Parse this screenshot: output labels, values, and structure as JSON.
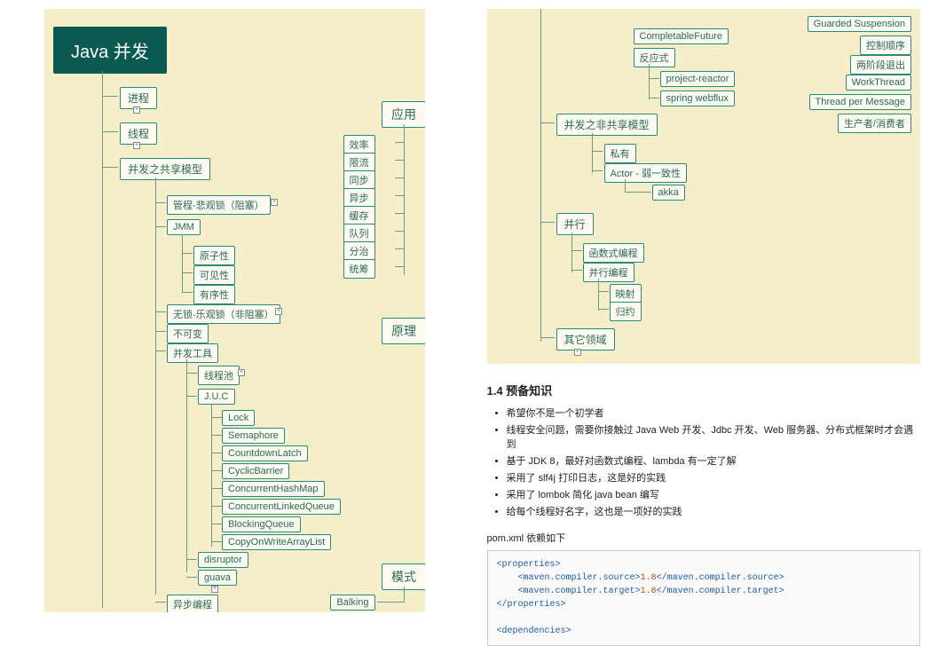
{
  "left": {
    "root": "Java 并发",
    "b1": "进程",
    "b2": "线程",
    "b3": "并发之共享模型",
    "b3_1": "管程-悲观锁（阻塞）",
    "b3_2": "JMM",
    "b3_2_1": "原子性",
    "b3_2_2": "可见性",
    "b3_2_3": "有序性",
    "b3_3": "无锁-乐观锁（非阻塞）",
    "b3_4": "不可变",
    "b3_5": "并发工具",
    "b3_5_1": "线程池",
    "b3_5_2": "J.U.C",
    "juc1": "Lock",
    "juc2": "Semaphore",
    "juc3": "CountdownLatch",
    "juc4": "CyclicBarrier",
    "juc5": "ConcurrentHashMap",
    "juc6": "ConcurrentLinkedQueue",
    "juc7": "BlockingQueue",
    "juc8": "CopyOnWriteArrayList",
    "b3_5_3": "disruptor",
    "b3_5_4": "guava",
    "b3_6": "异步编程",
    "app": "应用",
    "app1": "效率",
    "app2": "限流",
    "app3": "同步",
    "app4": "异步",
    "app5": "缓存",
    "app6": "队列",
    "app7": "分治",
    "app8": "统筹",
    "principle": "原理",
    "pattern": "模式",
    "pat1": "Balking"
  },
  "right": {
    "r1": "CompletableFuture",
    "r2": "反应式",
    "r2_1": "project-reactor",
    "r2_2": "spring webflux",
    "rp1": "Guarded Suspension",
    "rp2": "控制顺序",
    "rp3": "两阶段退出",
    "rp4": "WorkThread",
    "rp5": "Thread per Message",
    "rp6": "生产者/消费者",
    "nb": "并发之非共享模型",
    "nb1": "私有",
    "nb2": "Actor - 弱一致性",
    "nb2_1": "akka",
    "par": "并行",
    "par1": "函数式编程",
    "par2": "并行编程",
    "par2_1": "映射",
    "par2_2": "归约",
    "other": "其它领域"
  },
  "prereqTitle": "1.4 预备知识",
  "prereq": [
    "希望你不是一个初学者",
    "线程安全问题，需要你接触过 Java Web 开发、Jdbc 开发、Web 服务器、分布式框架时才会遇到",
    "基于 JDK 8，最好对函数式编程、lambda 有一定了解",
    "采用了 slf4j 打印日志，这是好的实践",
    "采用了 lombok 简化 java bean 编写",
    "给每个线程好名字，这也是一项好的实践"
  ],
  "pomLabel": "pom.xml 依赖如下",
  "code": {
    "p_open": "<properties>",
    "src_o": "<maven.compiler.source>",
    "src_v": "1.8",
    "src_c": "</maven.compiler.source>",
    "tgt_o": "<maven.compiler.target>",
    "tgt_v": "1.8",
    "tgt_c": "</maven.compiler.target>",
    "p_close": "</properties>",
    "d_open": "<dependencies>"
  }
}
